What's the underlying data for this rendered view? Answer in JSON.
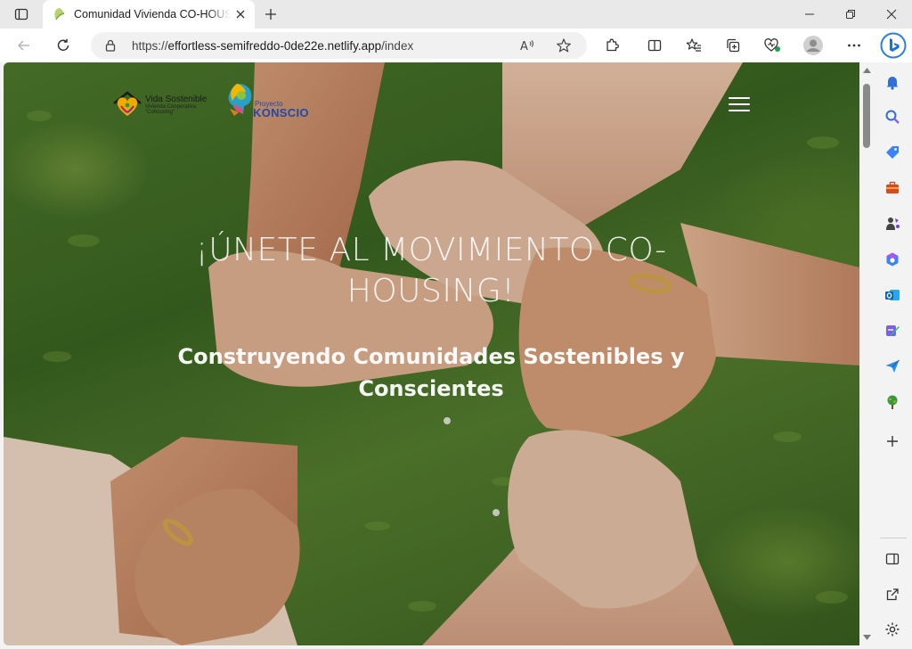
{
  "browser": {
    "tab": {
      "title": "Comunidad Vivienda CO-HOUSING",
      "favicon": "site-favicon"
    },
    "address": {
      "url_prefix": "https://",
      "url_host": "effortless-semifreddo-0de22e.netlify.app",
      "url_path": "/index"
    },
    "window_controls": [
      "minimize-icon",
      "restore-icon",
      "close-icon"
    ],
    "toolbar_icons": [
      "back-arrow-icon",
      "refresh-icon",
      "lock-icon",
      "read-aloud-icon",
      "favorite-star-icon",
      "extensions-icon",
      "split-screen-icon",
      "favorites-icon",
      "collections-icon",
      "browser-essentials-icon",
      "profile-icon",
      "more-icon",
      "bing-copilot-icon"
    ],
    "sidebar_icons": [
      "bell-icon",
      "search-icon",
      "shopping-tag-icon",
      "tools-briefcase-icon",
      "games-icon",
      "microsoft-365-icon",
      "outlook-icon",
      "designer-icon",
      "send-icon",
      "tree-icon",
      "add-icon",
      "sidebar-toggle-icon",
      "external-link-icon",
      "settings-icon"
    ]
  },
  "site": {
    "logo1": {
      "line1": "Vida Sostenible",
      "line2": "Vivienda Cooperativa",
      "line3": "\"Cohousing\""
    },
    "logo2": {
      "small": "Proyecto",
      "big": "KONSCIO"
    },
    "hero": {
      "title": "¡ÚNETE AL MOVIMIENTO CO-HOUSING!",
      "subtitle": "Construyendo Comunidades Sostenibles y Conscientes"
    }
  },
  "colors": {
    "tab_strip": "#e9e9e9",
    "address_bar": "#f1f1f1",
    "accent_blue": "#1f4aa8",
    "hero_text": "#ffffff",
    "grass": "#4e7a2c"
  }
}
